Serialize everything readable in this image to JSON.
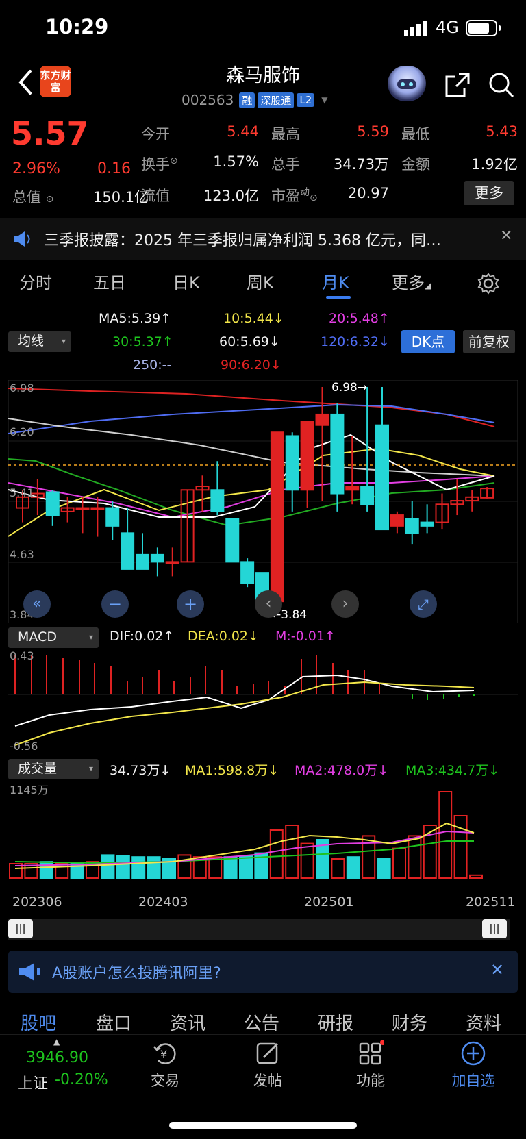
{
  "status": {
    "time": "10:29",
    "network": "4G"
  },
  "header": {
    "logo": "东方财富",
    "name": "森马服饰",
    "code": "002563",
    "tags": [
      "融",
      "深股通",
      "L2"
    ]
  },
  "quote": {
    "price": "5.57",
    "change_pct": "2.96%",
    "change_val": "0.16",
    "open_label": "今开",
    "open": "5.44",
    "high_label": "最高",
    "high": "5.59",
    "low_label": "最低",
    "low": "5.43",
    "turnover_label": "换手",
    "turnover": "1.57%",
    "volume_label": "总手",
    "volume": "34.73万",
    "amount_label": "金额",
    "amount": "1.92亿",
    "mktcap_label": "总值",
    "mktcap": "150.1亿",
    "float_label": "流值",
    "float": "123.0亿",
    "pe_label": "市盈",
    "pe_sup": "动",
    "pe": "20.97",
    "more": "更多"
  },
  "news": {
    "text": "三季报披露：2025 年三季报归属净利润 5.368 亿元，同…"
  },
  "tabs": [
    "分时",
    "五日",
    "日K",
    "周K",
    "月K",
    "更多"
  ],
  "active_tab": "月K",
  "ma_legend": {
    "selector": "均线",
    "ma5": "MA5:5.39↑",
    "ma10": "10:5.44↓",
    "ma20": "20:5.48↑",
    "ma30": "30:5.37↑",
    "ma60": "60:5.69↓",
    "ma120": "120:6.32↓",
    "ma250": "250:--",
    "ma90": "90:6.20↓",
    "dk": "DK点",
    "fq": "前复权"
  },
  "price_axis": [
    "6.98",
    "6.20",
    "5.41",
    "4.63",
    "3.84"
  ],
  "chart_annotations": {
    "max": "6.98→",
    "min": "←3.84"
  },
  "macd": {
    "selector": "MACD",
    "dif": "DIF:0.02↑",
    "dea": "DEA:0.02↓",
    "m": "M:-0.01↑",
    "axis_top": "0.43",
    "axis_bottom": "-0.56"
  },
  "volume": {
    "selector": "成交量",
    "value": "34.73万↓",
    "ma1": "MA1:598.8万↓",
    "ma2": "MA2:478.0万↓",
    "ma3": "MA3:434.7万↓",
    "axis_top": "1145万"
  },
  "dates": [
    "202306",
    "202403",
    "202501",
    "202511"
  ],
  "promo": {
    "text": "A股账户怎么投腾讯阿里?"
  },
  "subtabs": [
    "股吧",
    "盘口",
    "资讯",
    "公告",
    "研报",
    "财务",
    "资料"
  ],
  "index": {
    "value": "3946.90",
    "name": "上证",
    "change": "-0.20%"
  },
  "nav": [
    "交易",
    "发帖",
    "功能",
    "加自选"
  ],
  "chart_data": {
    "type": "candlestick",
    "period": "monthly",
    "x_range": [
      "202306",
      "202511"
    ],
    "ylim": [
      3.84,
      6.98
    ],
    "candles": [
      {
        "o": 5.3,
        "h": 5.55,
        "l": 5.1,
        "c": 5.45
      },
      {
        "o": 5.45,
        "h": 5.7,
        "l": 5.2,
        "c": 5.5
      },
      {
        "o": 5.52,
        "h": 5.55,
        "l": 5.05,
        "c": 5.2
      },
      {
        "o": 5.25,
        "h": 5.45,
        "l": 5.1,
        "c": 5.3
      },
      {
        "o": 5.3,
        "h": 5.45,
        "l": 4.95,
        "c": 5.3
      },
      {
        "o": 5.3,
        "h": 5.45,
        "l": 4.9,
        "c": 5.3
      },
      {
        "o": 5.3,
        "h": 5.4,
        "l": 4.85,
        "c": 5.05
      },
      {
        "o": 4.95,
        "h": 5.3,
        "l": 4.45,
        "c": 4.45
      },
      {
        "o": 4.65,
        "h": 4.95,
        "l": 4.45,
        "c": 4.45
      },
      {
        "o": 4.65,
        "h": 4.75,
        "l": 4.35,
        "c": 4.55
      },
      {
        "o": 4.55,
        "h": 4.75,
        "l": 4.35,
        "c": 4.55
      },
      {
        "o": 4.55,
        "h": 5.55,
        "l": 4.55,
        "c": 5.55
      },
      {
        "o": 5.55,
        "h": 5.75,
        "l": 5.25,
        "c": 5.6
      },
      {
        "o": 5.55,
        "h": 5.95,
        "l": 5.2,
        "c": 5.25
      },
      {
        "o": 5.15,
        "h": 5.15,
        "l": 4.55,
        "c": 4.55
      },
      {
        "o": 4.55,
        "h": 4.6,
        "l": 4.2,
        "c": 4.25
      },
      {
        "o": 4.4,
        "h": 4.4,
        "l": 3.84,
        "c": 3.95
      },
      {
        "o": 4.0,
        "h": 5.6,
        "l": 3.84,
        "c": 6.35
      },
      {
        "o": 6.3,
        "h": 6.35,
        "l": 5.25,
        "c": 5.55
      },
      {
        "o": 5.55,
        "h": 6.5,
        "l": 5.3,
        "c": 6.5
      },
      {
        "o": 6.45,
        "h": 6.98,
        "l": 5.4,
        "c": 6.6
      },
      {
        "o": 6.6,
        "h": 6.75,
        "l": 5.25,
        "c": 5.5
      },
      {
        "o": 5.55,
        "h": 6.3,
        "l": 5.35,
        "c": 5.6
      },
      {
        "o": 5.6,
        "h": 6.98,
        "l": 5.25,
        "c": 5.35
      },
      {
        "o": 6.45,
        "h": 6.98,
        "l": 5.0,
        "c": 5.0
      },
      {
        "o": 5.05,
        "h": 5.25,
        "l": 4.95,
        "c": 5.2
      },
      {
        "o": 5.15,
        "h": 5.4,
        "l": 4.8,
        "c": 4.95
      },
      {
        "o": 5.1,
        "h": 5.35,
        "l": 4.95,
        "c": 5.05
      },
      {
        "o": 5.1,
        "h": 5.5,
        "l": 5.0,
        "c": 5.35
      },
      {
        "o": 5.35,
        "h": 5.7,
        "l": 5.2,
        "c": 5.4
      },
      {
        "o": 5.4,
        "h": 5.55,
        "l": 5.25,
        "c": 5.45
      },
      {
        "o": 5.44,
        "h": 5.59,
        "l": 5.43,
        "c": 5.57
      }
    ],
    "current_price": 5.57
  }
}
